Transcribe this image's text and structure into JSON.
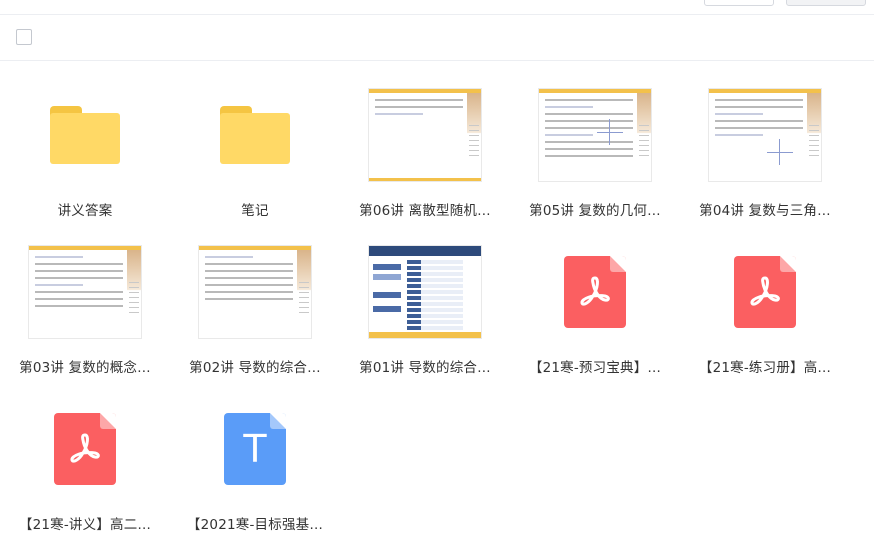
{
  "toolbar": {
    "checkbox_label": ""
  },
  "items": [
    {
      "name": "讲义答案",
      "type": "folder"
    },
    {
      "name": "笔记",
      "type": "folder"
    },
    {
      "name": "第06讲  离散型随机…",
      "type": "doc"
    },
    {
      "name": "第05讲  复数的几何…",
      "type": "doc"
    },
    {
      "name": "第04讲  复数与三角…",
      "type": "doc"
    },
    {
      "name": "第03讲  复数的概念…",
      "type": "doc"
    },
    {
      "name": "第02讲  导数的综合…",
      "type": "doc"
    },
    {
      "name": "第01讲  导数的综合…",
      "type": "toc"
    },
    {
      "name": "【21寒-预习宝典】…",
      "type": "pdf"
    },
    {
      "name": "【21寒-练习册】高…",
      "type": "pdf"
    },
    {
      "name": "【21寒-讲义】高二…",
      "type": "pdf"
    },
    {
      "name": "【2021寒-目标强基…",
      "type": "txt"
    }
  ],
  "icons": {
    "folder": "folder-icon",
    "pdf": "pdf-file-icon",
    "txt": "text-file-icon",
    "txt_letter": "T"
  },
  "colors": {
    "folder": "#ffd966",
    "pdf": "#fb5f61",
    "txt": "#5a9cf8",
    "doc_band": "#f3c14b"
  }
}
